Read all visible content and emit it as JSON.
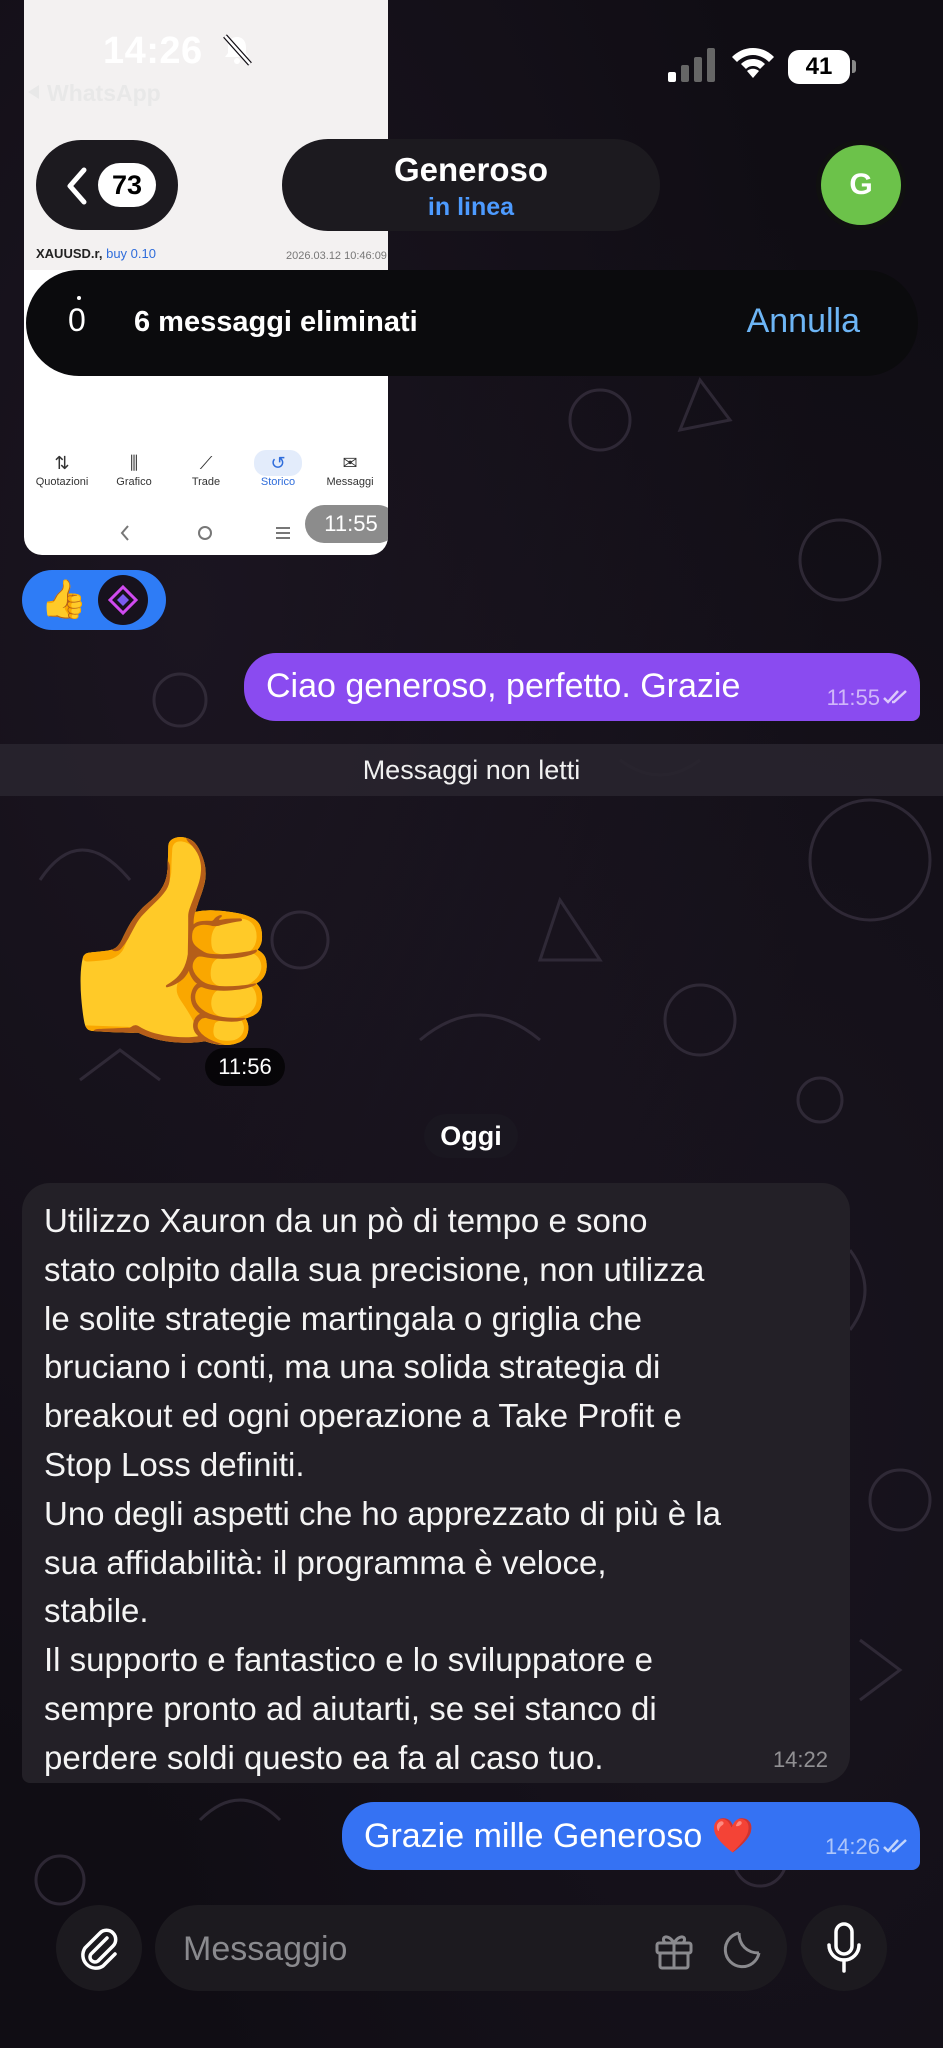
{
  "status_bar": {
    "time": "14:26",
    "back_app": "WhatsApp",
    "battery": "41"
  },
  "header": {
    "unread_count": "73",
    "contact_name": "Generoso",
    "contact_status": "in linea",
    "avatar_initial": "G"
  },
  "screenshot_message": {
    "rows": [
      {
        "symbol": "XAUUSD.r,",
        "side": "buy 0.10",
        "date": "2026.03.12 10:46:09"
      }
    ],
    "tabs": [
      {
        "label": "Quotazioni",
        "icon": "⇅"
      },
      {
        "label": "Grafico",
        "icon": "⫼"
      },
      {
        "label": "Trade",
        "icon": "⟋"
      },
      {
        "label": "Storico",
        "icon": "↺"
      },
      {
        "label": "Messaggi",
        "icon": "✉"
      }
    ],
    "time": "11:55"
  },
  "deleted_banner": {
    "counter": "0",
    "text": "6 messaggi eliminati",
    "undo": "Annulla"
  },
  "reaction": {
    "emoji": "👍"
  },
  "messages": {
    "out1": {
      "text": "Ciao generoso, perfetto. Grazie",
      "time": "11:55"
    },
    "unread_label": "Messaggi non letti",
    "sticker": {
      "emoji": "👍",
      "time": "11:56"
    },
    "date_chip": "Oggi",
    "in1": {
      "text": "Utilizzo Xauron da un pò di tempo e sono\nstato colpito dalla sua precisione, non utilizza\nle solite strategie martingala o griglia che\nbruciano i conti, ma una solida strategia di\nbreakout ed ogni operazione a Take Profit e\nStop Loss definiti.\nUno degli aspetti che ho apprezzato di più è la\nsua affidabilità: il programma è veloce,\nstabile.\nIl supporto e fantastico e lo sviluppatore e\nsempre pronto ad aiutarti, se sei stanco di\nperdere soldi questo ea fa al caso tuo.",
      "time": "14:22"
    },
    "out2": {
      "text": "Grazie mille Generoso ❤️",
      "time": "14:26"
    }
  },
  "composer": {
    "placeholder": "Messaggio"
  },
  "colors": {
    "outgoing_purple": "#8a4bf0",
    "outgoing_blue": "#3572f3",
    "link_blue": "#4d9bff",
    "avatar_green": "#6cc24a"
  }
}
